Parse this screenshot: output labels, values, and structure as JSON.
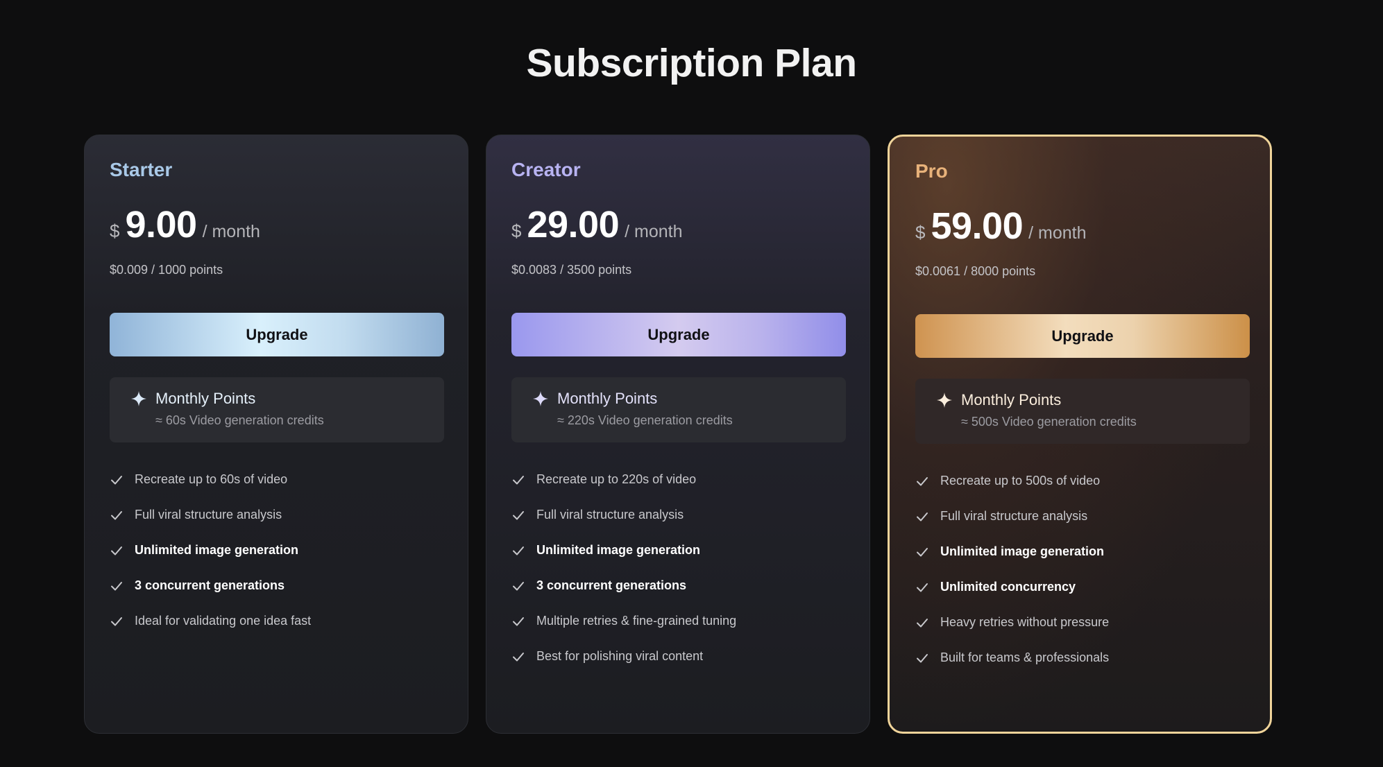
{
  "page": {
    "title": "Subscription Plan"
  },
  "colors": {
    "background": "#0e0e0f",
    "starter_accent": "#a9c9e8",
    "creator_accent": "#b8b3f2",
    "pro_accent": "#e8b27a",
    "pro_border": "#f0d49a"
  },
  "plans": [
    {
      "name": "Starter",
      "currency": "$",
      "price": "9.00",
      "period": "/ month",
      "unit_price": "$0.009 / 1000 points",
      "button": "Upgrade",
      "points_title": "Monthly Points",
      "points_sub": "≈ 60s Video generation credits",
      "icon": "sparkle-icon",
      "features": [
        {
          "text": "Recreate up to 60s of video",
          "bold": false
        },
        {
          "text": "Full viral structure analysis",
          "bold": false
        },
        {
          "text": "Unlimited image generation",
          "bold": true
        },
        {
          "text": "3 concurrent generations",
          "bold": true
        },
        {
          "text": "Ideal for validating one idea fast",
          "bold": false
        }
      ]
    },
    {
      "name": "Creator",
      "currency": "$",
      "price": "29.00",
      "period": "/ month",
      "unit_price": "$0.0083 / 3500 points",
      "button": "Upgrade",
      "points_title": "Monthly Points",
      "points_sub": "≈ 220s Video generation credits",
      "icon": "sparkle-icon",
      "features": [
        {
          "text": "Recreate up to 220s of video",
          "bold": false
        },
        {
          "text": "Full viral structure analysis",
          "bold": false
        },
        {
          "text": "Unlimited image generation",
          "bold": true
        },
        {
          "text": "3 concurrent generations",
          "bold": true
        },
        {
          "text": "Multiple retries & fine-grained tuning",
          "bold": false
        },
        {
          "text": "Best for polishing viral content",
          "bold": false
        }
      ]
    },
    {
      "name": "Pro",
      "currency": "$",
      "price": "59.00",
      "period": "/ month",
      "unit_price": "$0.0061 / 8000 points",
      "button": "Upgrade",
      "points_title": "Monthly Points",
      "points_sub": "≈ 500s Video generation credits",
      "icon": "sparkle-icon",
      "features": [
        {
          "text": "Recreate up to 500s of video",
          "bold": false
        },
        {
          "text": "Full viral structure analysis",
          "bold": false
        },
        {
          "text": "Unlimited image generation",
          "bold": true
        },
        {
          "text": "Unlimited concurrency",
          "bold": true
        },
        {
          "text": "Heavy retries without pressure",
          "bold": false
        },
        {
          "text": "Built for teams & professionals",
          "bold": false
        }
      ]
    }
  ]
}
